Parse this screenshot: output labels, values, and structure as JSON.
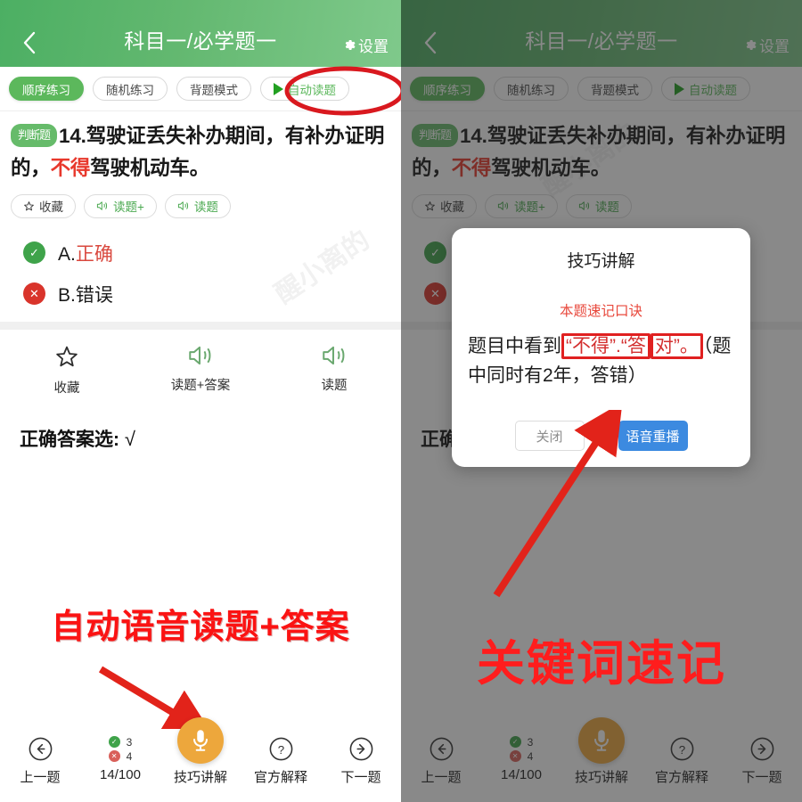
{
  "header": {
    "title": "科目一/必学题一",
    "settings_label": "设置",
    "back_icon": "chevron-left-icon",
    "gear_icon": "gear-icon"
  },
  "modes": [
    {
      "label": "顺序练习",
      "active": true
    },
    {
      "label": "随机练习",
      "active": false
    },
    {
      "label": "背题模式",
      "active": false
    },
    {
      "label": "自动读题",
      "active": false,
      "icon": "play-icon"
    }
  ],
  "question": {
    "tag": "判断题",
    "number": "14.",
    "text_before": "驾驶证丢失补办期间，有补办证明的，",
    "highlight": "不得",
    "text_after": "驾驶机动车。",
    "pills": [
      {
        "label": "收藏",
        "icon": "star-icon"
      },
      {
        "label": "读题+",
        "icon": "speaker-icon"
      },
      {
        "label": "读题",
        "icon": "speaker-icon"
      }
    ]
  },
  "options": [
    {
      "badge": "correct",
      "badge_glyph": "✓",
      "prefix": "A.",
      "label": "正确"
    },
    {
      "badge": "wrong",
      "badge_glyph": "✕",
      "prefix": "B.",
      "label": "错误"
    }
  ],
  "actions": [
    {
      "label": "收藏",
      "icon": "star-icon"
    },
    {
      "label": "读题+答案",
      "icon": "speaker-icon"
    },
    {
      "label": "读题",
      "icon": "speaker-icon"
    }
  ],
  "answer": {
    "label": "正确答案选:",
    "value": "√"
  },
  "bottom_nav": {
    "prev": {
      "label": "上一题",
      "icon": "arrow-left-circle-icon"
    },
    "progress": {
      "label": "14/100",
      "correct_count": "3",
      "wrong_count": "4"
    },
    "skill": {
      "label": "技巧讲解",
      "icon": "microphone-icon"
    },
    "official": {
      "label": "官方解释",
      "icon": "question-circle-icon"
    },
    "next": {
      "label": "下一题",
      "icon": "arrow-right-circle-icon"
    }
  },
  "modal": {
    "title": "技巧讲解",
    "subtitle": "本题速记口诀",
    "body_1": "题目中看到",
    "body_boxed_1": "“不得”.“答",
    "body_boxed_2": "对”。",
    "body_2": "（题中同时有2年，答错）",
    "close_label": "关闭",
    "replay_label": "语音重播"
  },
  "annotations": {
    "promo_left": "自动语音读题+答案",
    "promo_right": "关键词速记"
  },
  "watermark": {
    "text": "醒小离的"
  },
  "colors": {
    "header_green": "#63b870",
    "chip_green": "#5cb85c",
    "accent_red": "#e8382c",
    "mic_orange": "#eda73c",
    "primary_blue": "#3c8ae0",
    "annotation_red": "#ff1d1d"
  }
}
